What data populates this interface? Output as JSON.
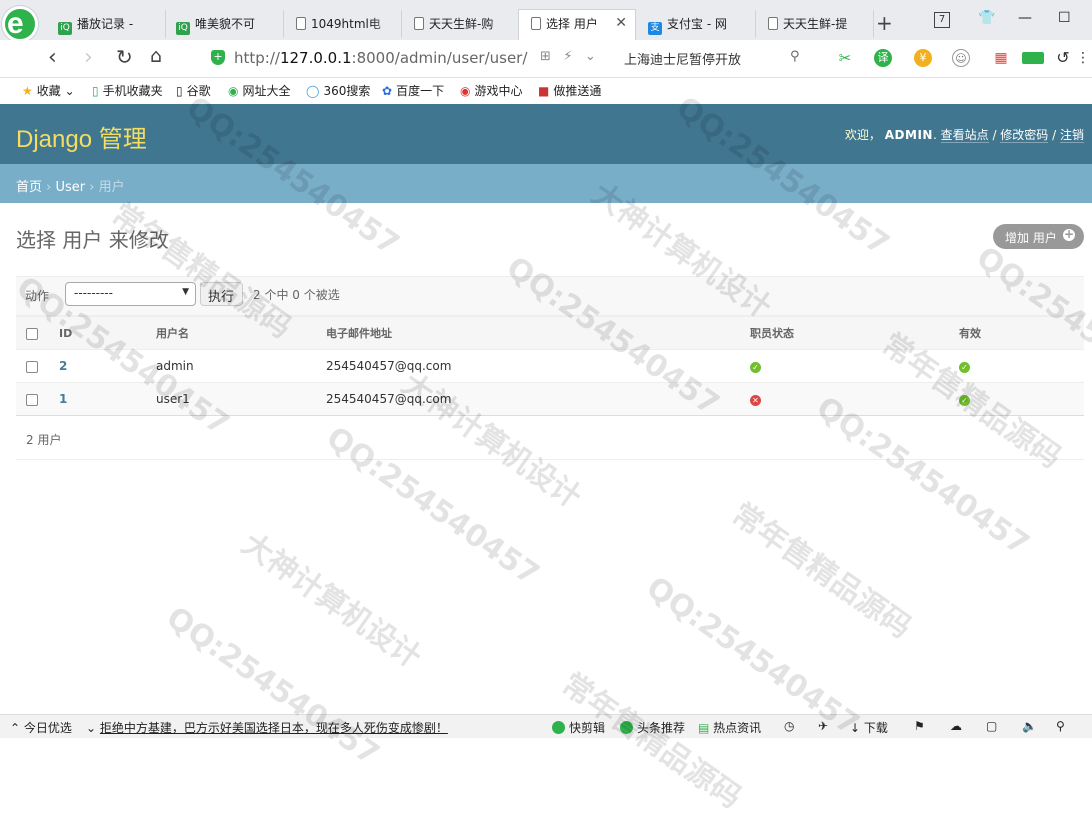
{
  "browser": {
    "tabs": [
      {
        "label": "播放记录 -",
        "icon": "video-site-icon"
      },
      {
        "label": "唯美貌不可",
        "icon": "video-site-icon"
      },
      {
        "label": "1049html电",
        "icon": "document-icon"
      },
      {
        "label": "天天生鲜-购",
        "icon": "document-icon"
      },
      {
        "label": "选择 用户",
        "icon": "document-icon",
        "active": true
      },
      {
        "label": "支付宝 - 网",
        "icon": "alipay-icon"
      },
      {
        "label": "天天生鲜-提",
        "icon": "document-icon"
      }
    ],
    "tab_count": "7",
    "url_prefix": "http://",
    "url_host": "127.0.0.1",
    "url_rest": ":8000/admin/user/user/",
    "search_text": "上海迪士尼暂停开放",
    "bookmarks": [
      "收藏",
      "手机收藏夹",
      "谷歌",
      "网址大全",
      "360搜索",
      "百度一下",
      "游戏中心",
      "做推送通"
    ]
  },
  "header": {
    "brand_prefix": "Django",
    "brand_suffix": "管理",
    "welcome": "欢迎，",
    "username": "ADMIN",
    "view_site": "查看站点",
    "change_password": "修改密码",
    "logout": "注销"
  },
  "breadcrumbs": {
    "home": "首页",
    "app": "User",
    "current": "用户"
  },
  "content": {
    "title": "选择 用户 来修改",
    "add_button": "增加 用户",
    "action_label": "动作",
    "action_select": "---------",
    "go_button": "执行",
    "selected_count": "2 个中 0 个被选",
    "columns": [
      "ID",
      "用户名",
      "电子邮件地址",
      "职员状态",
      "有效"
    ],
    "rows": [
      {
        "id": "2",
        "username": "admin",
        "email": "254540457@qq.com",
        "is_staff": true,
        "is_active": true
      },
      {
        "id": "1",
        "username": "user1",
        "email": "254540457@qq.com",
        "is_staff": false,
        "is_active": true
      }
    ],
    "paginator": "2 用户"
  },
  "statusbar": {
    "left": "今日优选",
    "news": "拒绝中方基建，巴方示好美国选择日本，现在多人死伤变成惨剧！",
    "items": [
      "快剪辑",
      "头条推荐",
      "热点资讯",
      "下载"
    ]
  },
  "watermark": [
    "QQ:254540457",
    "大神计算机设计",
    "常年售精品源码"
  ],
  "colors": {
    "header": "#417690",
    "breadcrumbs": "#79aec8",
    "brand": "#f5dd5d",
    "link": "#447e9b"
  }
}
